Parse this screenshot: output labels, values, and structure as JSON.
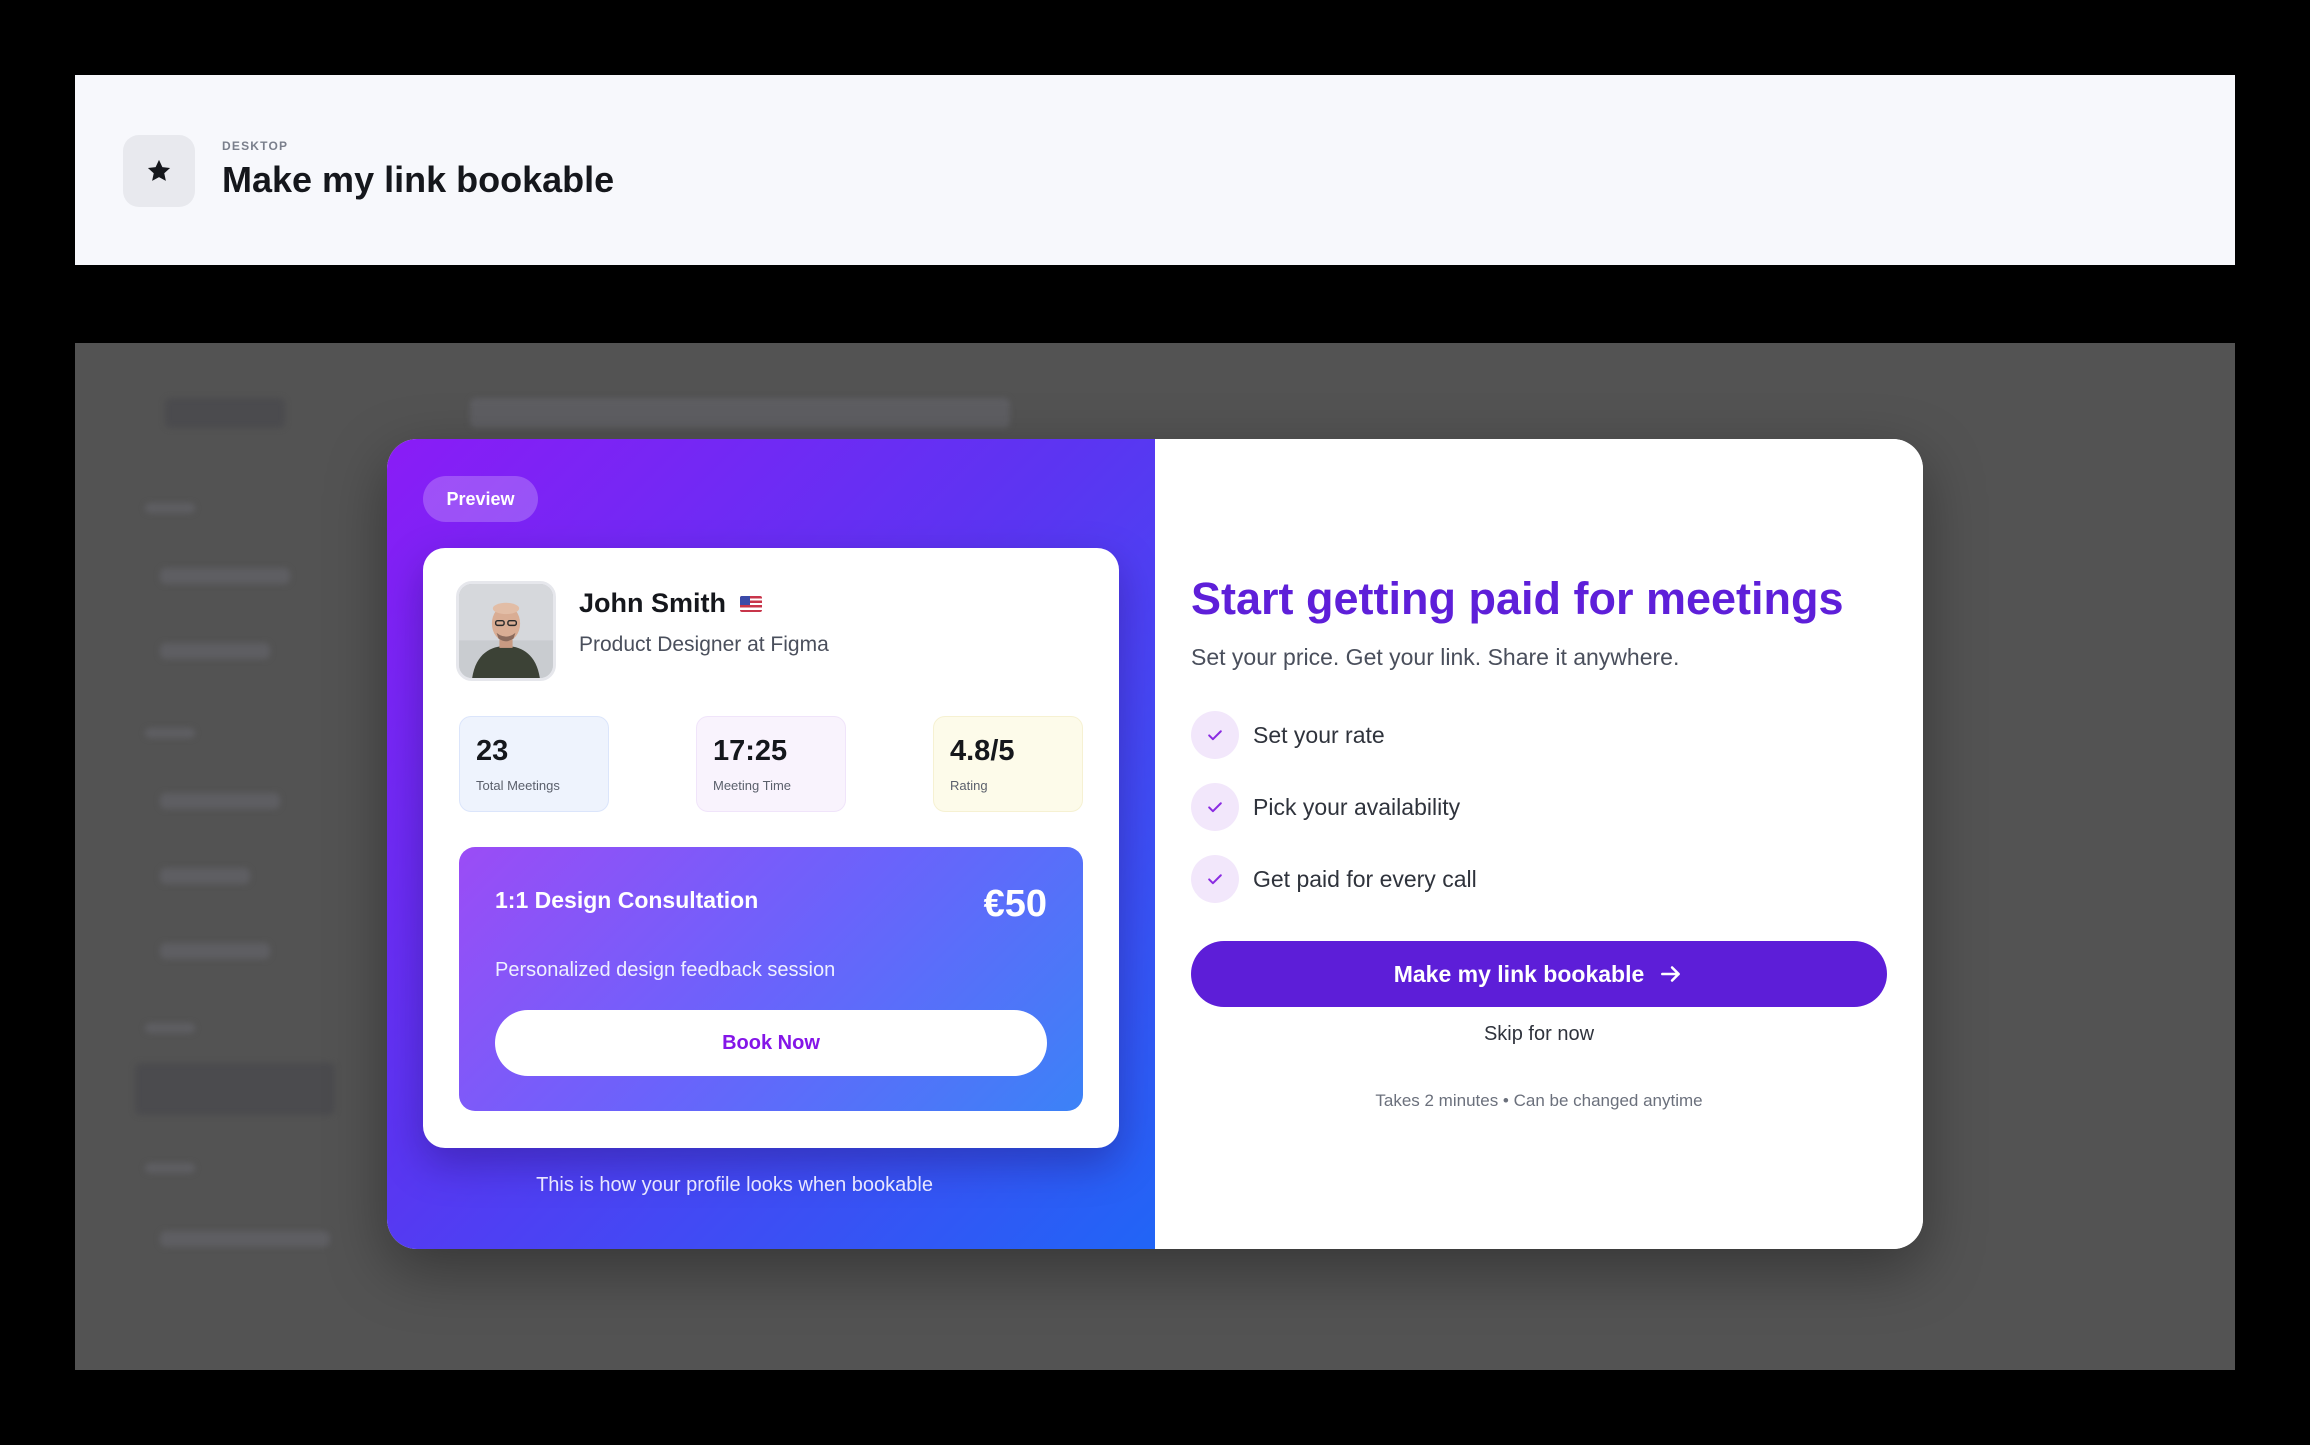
{
  "header": {
    "eyebrow": "DESKTOP",
    "title": "Make my link bookable",
    "icon": "star-icon"
  },
  "modal": {
    "preview": {
      "pill_label": "Preview",
      "profile": {
        "name": "John Smith",
        "flag": "us-flag-icon",
        "role": "Product Designer at Figma"
      },
      "stats": [
        {
          "value": "23",
          "label": "Total Meetings"
        },
        {
          "value": "17:25",
          "label": "Meeting Time"
        },
        {
          "value": "4.8/5",
          "label": "Rating"
        }
      ],
      "offer": {
        "title": "1:1 Design Consultation",
        "price": "€50",
        "description": "Personalized design feedback session",
        "button_label": "Book Now"
      },
      "caption": "This is how your profile looks when bookable"
    },
    "content": {
      "headline": "Start getting paid for meetings",
      "subline": "Set your price. Get your link. Share it anywhere.",
      "features": [
        {
          "label": "Set your rate",
          "icon": "check-icon"
        },
        {
          "label": "Pick your availability",
          "icon": "check-icon"
        },
        {
          "label": "Get paid for every call",
          "icon": "check-icon"
        }
      ],
      "cta_label": "Make my link bookable",
      "cta_icon": "arrow-right-icon",
      "skip_label": "Skip for now",
      "footnote": "Takes 2 minutes • Can be changed anytime"
    }
  },
  "colors": {
    "accent": "#5d1ed8",
    "headline": "#5e1fd9",
    "gradient_start": "#8a1cf6",
    "gradient_end": "#2165f6",
    "book_text": "#8415e8"
  }
}
